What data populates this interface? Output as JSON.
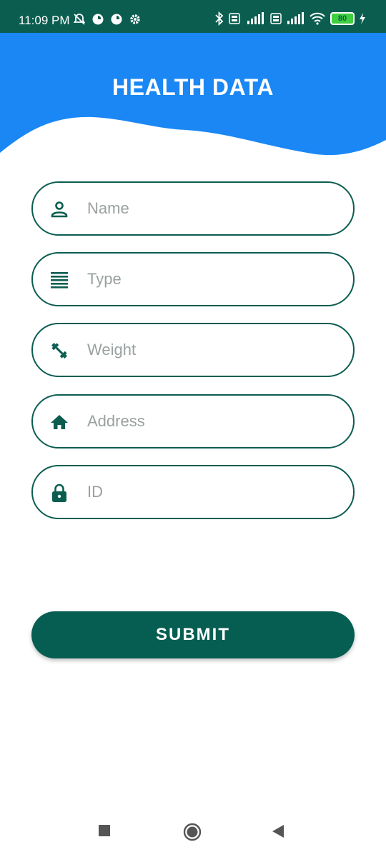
{
  "status_bar": {
    "time": "11:09 PM",
    "battery": "80",
    "background_color": "#0b5d50"
  },
  "header": {
    "title": "HEALTH DATA",
    "background_color": "#1a87f5"
  },
  "form": {
    "fields": [
      {
        "placeholder": "Name",
        "value": "",
        "icon": "person-icon"
      },
      {
        "placeholder": "Type",
        "value": "",
        "icon": "lines-icon"
      },
      {
        "placeholder": "Weight",
        "value": "",
        "icon": "dumbbell-icon"
      },
      {
        "placeholder": "Address",
        "value": "",
        "icon": "home-icon"
      },
      {
        "placeholder": "ID",
        "value": "",
        "icon": "lock-icon"
      }
    ],
    "accent_color": "#0b5d50"
  },
  "submit": {
    "label": "SUBMIT",
    "background_color": "#065e52"
  },
  "nav": {
    "items": [
      "recents-button",
      "home-button",
      "back-button"
    ]
  }
}
